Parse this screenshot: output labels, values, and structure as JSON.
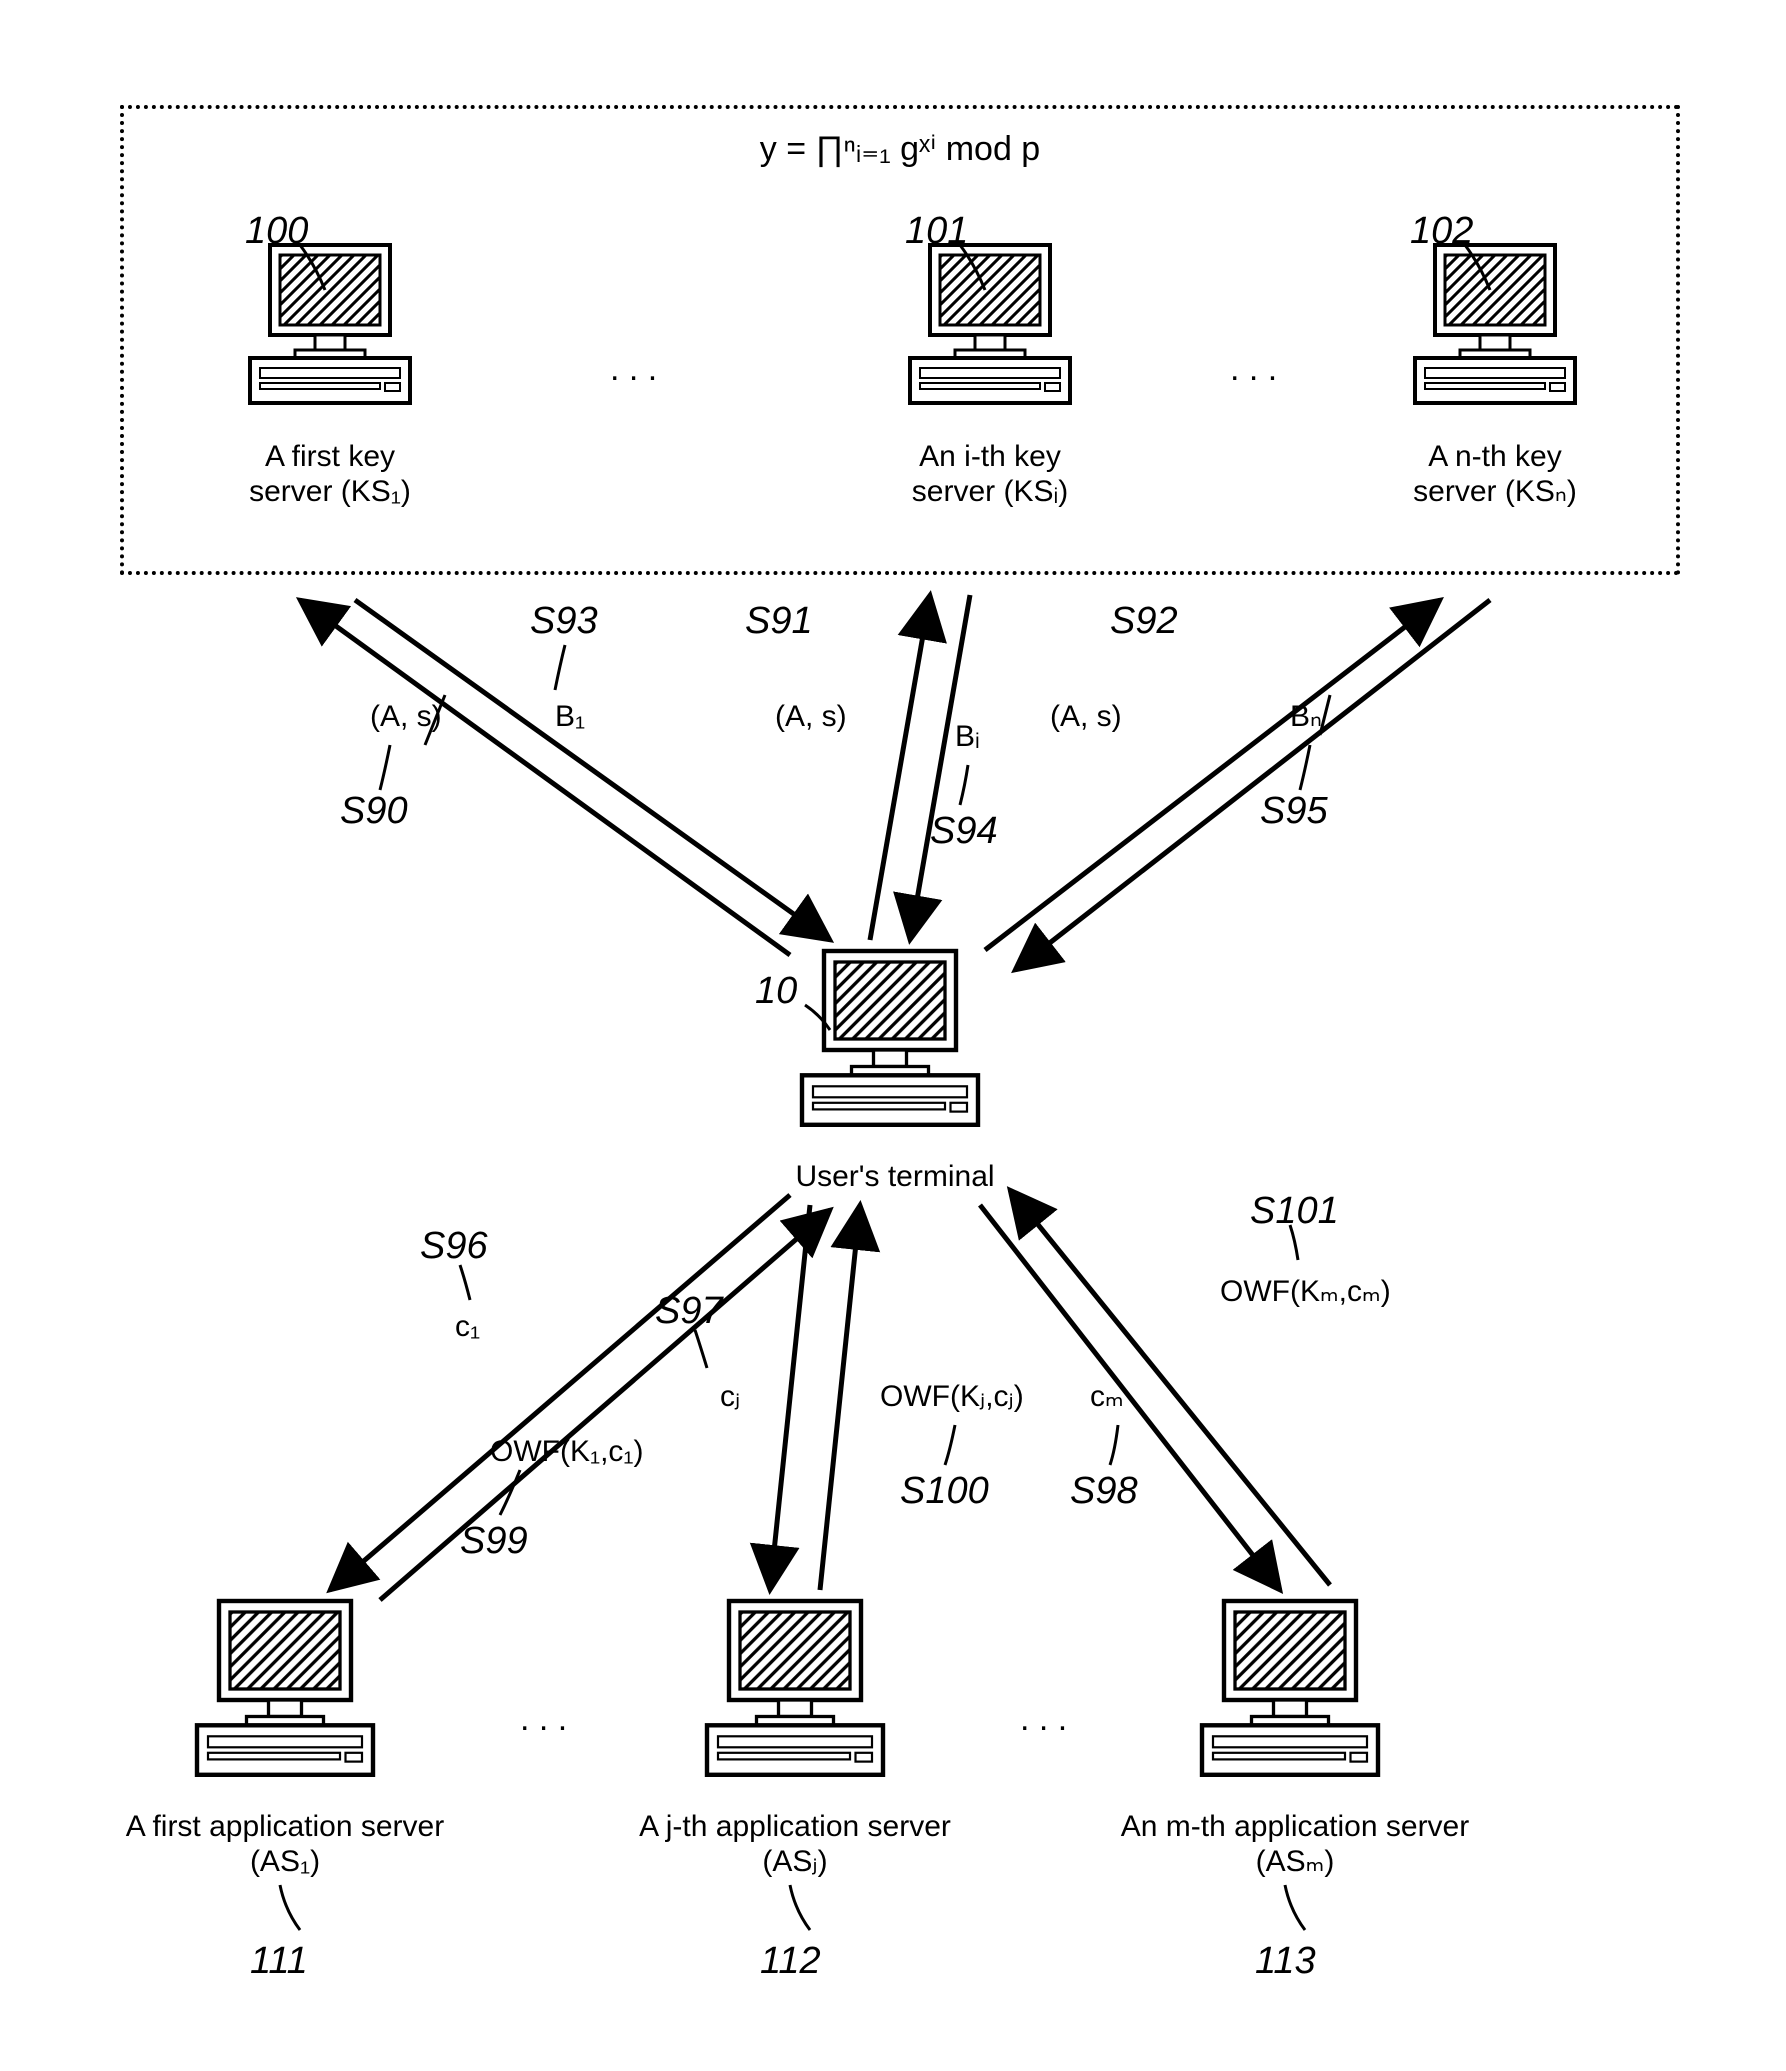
{
  "formula": {
    "text": "y = ∏ⁿᵢ₌₁ gˣⁱ mod p"
  },
  "key_servers": {
    "ks1": {
      "ref": "100",
      "label": "A first key\nserver (KS₁)"
    },
    "ksi": {
      "ref": "101",
      "label": "An i-th key\nserver (KSᵢ)"
    },
    "ksn": {
      "ref": "102",
      "label": "A n-th key\nserver (KSₙ)"
    }
  },
  "ellipsis": ". . .",
  "user_terminal": {
    "ref": "10",
    "label": "User's terminal"
  },
  "app_servers": {
    "as1": {
      "ref": "111",
      "label": "A first application server\n(AS₁)"
    },
    "asj": {
      "ref": "112",
      "label": "A j-th application server\n(ASⱼ)"
    },
    "asm": {
      "ref": "113",
      "label": "An m-th application server\n(ASₘ)"
    }
  },
  "flows": {
    "S90": {
      "step": "S90",
      "msg": "(A, s)"
    },
    "S91": {
      "step": "S91",
      "msg": "(A, s)"
    },
    "S92": {
      "step": "S92",
      "msg": "(A, s)"
    },
    "S93": {
      "step": "S93",
      "msg": "B₁"
    },
    "S94": {
      "step": "S94",
      "msg": "Bᵢ"
    },
    "S95": {
      "step": "S95",
      "msg": "Bₙ"
    },
    "S96": {
      "step": "S96",
      "msg": "c₁"
    },
    "S97": {
      "step": "S97",
      "msg": "cⱼ"
    },
    "S98": {
      "step": "S98",
      "msg": "cₘ"
    },
    "S99": {
      "step": "S99",
      "msg": "OWF(K₁,c₁)"
    },
    "S100": {
      "step": "S100",
      "msg": "OWF(Kⱼ,cⱼ)"
    },
    "S101": {
      "step": "S101",
      "msg": "OWF(Kₘ,cₘ)"
    }
  }
}
